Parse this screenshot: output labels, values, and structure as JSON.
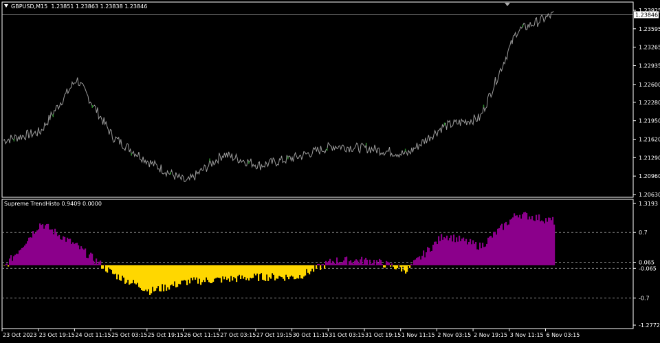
{
  "main": {
    "symbol": "GBPUSD,M15",
    "ohlc": "1.23851 1.23863 1.23838 1.23846",
    "current_price": "1.23846",
    "price_ticks": [
      "1.23925",
      "1.23595",
      "1.23265",
      "1.22935",
      "1.22600",
      "1.22280",
      "1.21950",
      "1.21620",
      "1.21290",
      "1.20960",
      "1.20630"
    ]
  },
  "indicator": {
    "name": "Supreme TrendHisto",
    "values": "0.9409 0.0000",
    "ticks": [
      "1.3193",
      "0.7",
      "0.065",
      "-0.065",
      "-0.7",
      "-1.2772"
    ]
  },
  "time_axis": [
    "23 Oct 2023",
    "23 Oct 19:15",
    "24 Oct 11:15",
    "25 Oct 03:15",
    "25 Oct 19:15",
    "26 Oct 11:15",
    "27 Oct 03:15",
    "27 Oct 19:15",
    "30 Oct 11:15",
    "31 Oct 03:15",
    "31 Oct 19:15",
    "1 Nov 11:15",
    "2 Nov 03:15",
    "2 Nov 19:15",
    "3 Nov 11:15",
    "6 Nov 03:15"
  ],
  "colors": {
    "background": "#000000",
    "price_line": "#9a9a9a",
    "bull_tick": "#2e8b2e",
    "histo_positive": "#8b008b",
    "histo_negative": "#ffd700",
    "grid": "#8c8c8c"
  },
  "chart_data": [
    {
      "type": "line",
      "title": "GBPUSD,M15",
      "x": [
        "23 Oct 2023",
        "23 Oct 19:15",
        "24 Oct 11:15",
        "25 Oct 03:15",
        "25 Oct 19:15",
        "26 Oct 11:15",
        "27 Oct 03:15",
        "27 Oct 19:15",
        "30 Oct 11:15",
        "31 Oct 03:15",
        "31 Oct 19:15",
        "1 Nov 11:15",
        "2 Nov 03:15",
        "2 Nov 19:15",
        "3 Nov 11:15",
        "6 Nov 03:15"
      ],
      "series": [
        {
          "name": "",
          "values": [
            1.216,
            1.2175,
            1.227,
            1.2165,
            1.212,
            1.2085,
            1.2135,
            1.2115,
            1.213,
            1.215,
            1.2145,
            1.2135,
            1.2185,
            1.22,
            1.2355,
            1.2385
          ]
        }
      ],
      "ylim": [
        1.2063,
        1.2395
      ]
    },
    {
      "type": "bar",
      "title": "Supreme TrendHisto",
      "x": [
        "23 Oct 2023",
        "23 Oct 19:15",
        "24 Oct 11:15",
        "25 Oct 03:15",
        "25 Oct 19:15",
        "26 Oct 11:15",
        "27 Oct 03:15",
        "27 Oct 19:15",
        "30 Oct 11:15",
        "31 Oct 03:15",
        "31 Oct 19:15",
        "1 Nov 11:15",
        "2 Nov 03:15",
        "2 Nov 19:15",
        "3 Nov 11:15",
        "6 Nov 03:15"
      ],
      "series": [
        {
          "name": "",
          "values": [
            -0.05,
            0.9,
            0.4,
            -0.2,
            -0.55,
            -0.35,
            -0.3,
            -0.25,
            -0.25,
            0.1,
            0.1,
            -0.1,
            0.65,
            0.4,
            1.1,
            0.94
          ]
        }
      ],
      "ylim": [
        -1.2772,
        1.3193
      ]
    }
  ]
}
